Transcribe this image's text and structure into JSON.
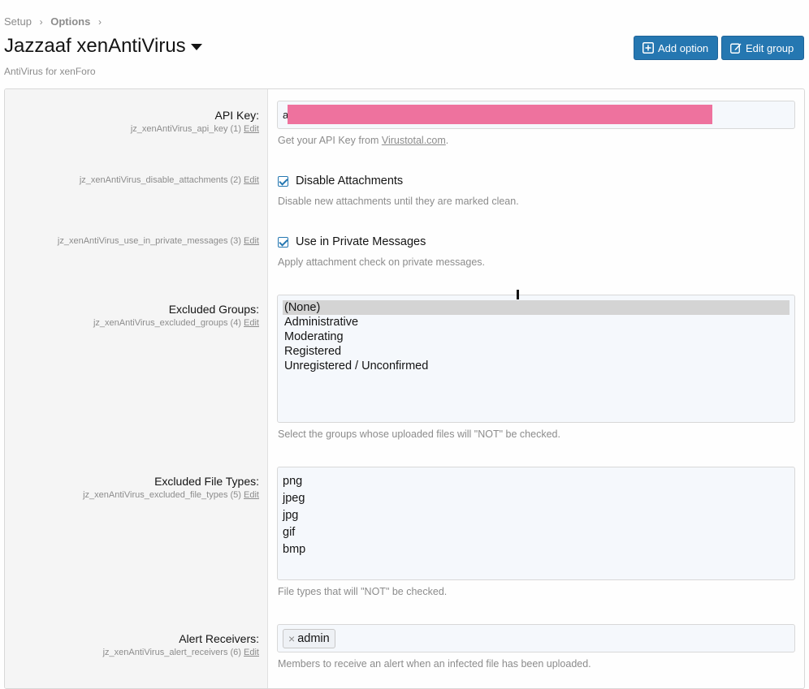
{
  "breadcrumb": {
    "items": [
      "Setup",
      "Options"
    ],
    "sep": "›"
  },
  "page": {
    "title": "Jazzaaf xenAntiVirus",
    "description": "AntiVirus for xenForo"
  },
  "actions": {
    "add_option": "Add option",
    "edit_group": "Edit group"
  },
  "colors": {
    "primary": "#2577b1",
    "redaction": "#ee729e"
  },
  "options": {
    "api_key": {
      "title": "API Key:",
      "hint": "jz_xenAntiVirus_api_key (1)",
      "edit": "Edit",
      "value_prefix": "a",
      "explain_prefix": "Get your API Key from ",
      "explain_link": "Virustotal.com",
      "explain_suffix": "."
    },
    "disable_attachments": {
      "hint": "jz_xenAntiVirus_disable_attachments (2)",
      "edit": "Edit",
      "label": "Disable Attachments",
      "checked": true,
      "explain": "Disable new attachments until they are marked clean."
    },
    "private_messages": {
      "hint": "jz_xenAntiVirus_use_in_private_messages (3)",
      "edit": "Edit",
      "label": "Use in Private Messages",
      "checked": true,
      "explain": "Apply attachment check on private messages."
    },
    "excluded_groups": {
      "title": "Excluded Groups:",
      "hint": "jz_xenAntiVirus_excluded_groups (4)",
      "edit": "Edit",
      "options": [
        "(None)",
        "Administrative",
        "Moderating",
        "Registered",
        "Unregistered / Unconfirmed"
      ],
      "selected": "(None)",
      "explain": "Select the groups whose uploaded files will \"NOT\" be checked."
    },
    "excluded_file_types": {
      "title": "Excluded File Types:",
      "hint": "jz_xenAntiVirus_excluded_file_types (5)",
      "edit": "Edit",
      "lines": [
        "png",
        "jpeg",
        "jpg",
        "gif",
        "bmp"
      ],
      "explain": "File types that will \"NOT\" be checked."
    },
    "alert_receivers": {
      "title": "Alert Receivers:",
      "hint": "jz_xenAntiVirus_alert_receivers (6)",
      "edit": "Edit",
      "tokens": [
        "admin"
      ],
      "remove_glyph": "×",
      "explain": "Members to receive an alert when an infected file has been uploaded."
    }
  }
}
